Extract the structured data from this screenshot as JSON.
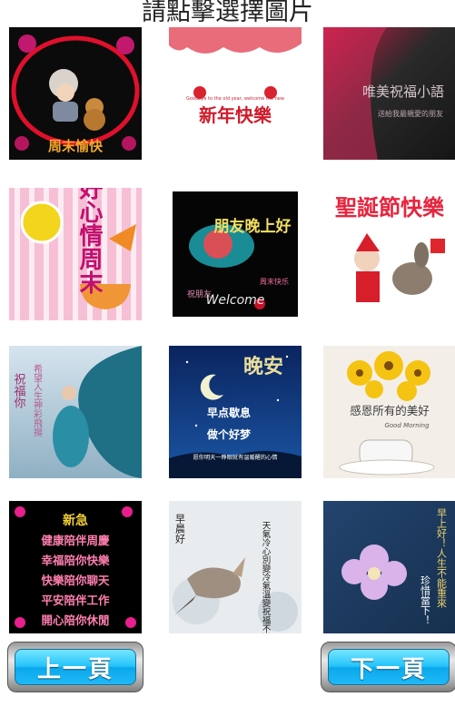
{
  "header": {
    "title": "請點擊選擇圖片"
  },
  "tiles": [
    {
      "caption": "周末愉快"
    },
    {
      "caption": "新年快樂",
      "subcaption": "Goodbye to the old year, welcome the new"
    },
    {
      "caption": "唯美祝福小語",
      "subcaption": "送給我最親愛的朋友"
    },
    {
      "caption": "好心情周末"
    },
    {
      "caption": "朋友晚上好",
      "side_left": "祝朋友",
      "side_right": "周末快乐",
      "script": "Welcome"
    },
    {
      "caption": "聖誕節快樂"
    },
    {
      "caption": "祝福你",
      "side": "希望人生神彩飛揚"
    },
    {
      "caption": "晚安",
      "line1": "早点歇息",
      "line2": "做个好梦",
      "line3": "愿你明天一睁眼就有温暖醒的心情"
    },
    {
      "caption": "感恩所有的美好",
      "script": "Good Morning"
    },
    {
      "caption": "新急",
      "lines": [
        "健康陪伴周慶",
        "幸福陪你快樂",
        "快樂陪你聊天",
        "平安陪伴工作",
        "開心陪你休閒"
      ]
    },
    {
      "caption": "早晨好",
      "poem": "天氣冷心別變冷氣溫變祝福不變"
    },
    {
      "caption": "早上好！人生不能重來",
      "line2": "珍惜當下！"
    }
  ],
  "nav": {
    "prev_label": "上一頁",
    "next_label": "下一頁"
  },
  "colors": {
    "button_blue": "#1fb9f7",
    "frame_red": "#e0102c"
  }
}
